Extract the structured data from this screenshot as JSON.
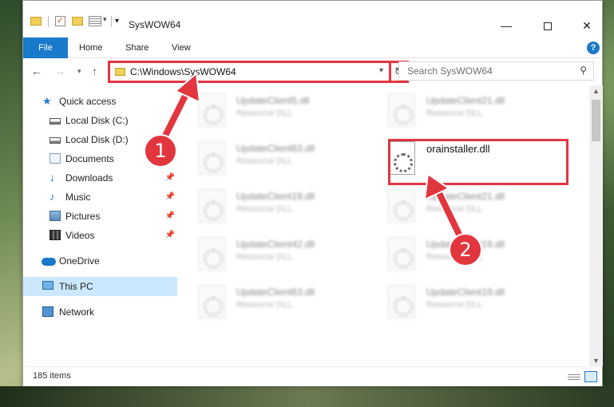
{
  "window": {
    "title": "SysWOW64"
  },
  "ribbon": {
    "tabs": [
      "File",
      "Home",
      "Share",
      "View"
    ],
    "help": "?"
  },
  "address": {
    "path": "C:\\Windows\\SysWOW64"
  },
  "search": {
    "placeholder": "Search SysWOW64"
  },
  "sidebar": {
    "items": [
      {
        "label": "Quick access",
        "icon": "star-icon"
      },
      {
        "label": "Local Disk (C:)",
        "icon": "disk-icon"
      },
      {
        "label": "Local Disk (D:)",
        "icon": "disk-icon"
      },
      {
        "label": "Documents",
        "icon": "documents-icon"
      },
      {
        "label": "Downloads",
        "icon": "download-icon"
      },
      {
        "label": "Music",
        "icon": "music-icon"
      },
      {
        "label": "Pictures",
        "icon": "pictures-icon"
      },
      {
        "label": "Videos",
        "icon": "video-icon"
      },
      {
        "label": "OneDrive",
        "icon": "cloud-icon"
      },
      {
        "label": "This PC",
        "icon": "computer-icon"
      },
      {
        "label": "Network",
        "icon": "network-icon"
      }
    ]
  },
  "files": [
    {
      "name": "UpdateClient5.dll",
      "type": "Resource DLL"
    },
    {
      "name": "UpdateClient21.dll",
      "type": "Resource DLL"
    },
    {
      "name": "UpdateClient63.dll",
      "type": "Resource DLL"
    },
    {
      "name": "orainstaller.dll",
      "type": ""
    },
    {
      "name": "UpdateClient19.dll",
      "type": "Resource DLL"
    },
    {
      "name": "UpdateClient21.dll",
      "type": "Resource DLL"
    },
    {
      "name": "UpdateClient42.dll",
      "type": "Resource DLL"
    },
    {
      "name": "UpdateClient19.dll",
      "type": "Resource DLL"
    },
    {
      "name": "UpdateClient63.dll",
      "type": "Resource DLL"
    },
    {
      "name": "UpdateClient19.dll",
      "type": "Resource DLL"
    }
  ],
  "status": {
    "count": "185 items"
  },
  "annotations": {
    "step1": "1",
    "step2": "2"
  },
  "colors": {
    "accent": "#1979ca",
    "annotation": "#e2363f",
    "selected": "#cce8ff"
  }
}
